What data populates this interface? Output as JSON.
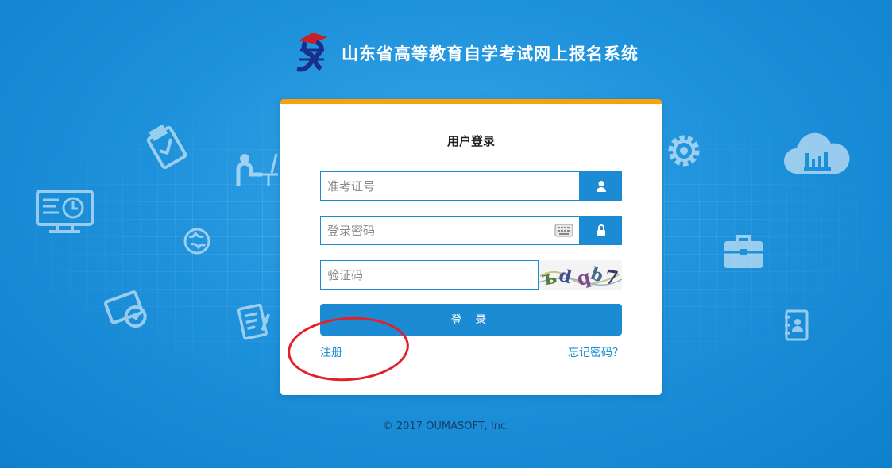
{
  "header": {
    "logo_icon": "exam-logo-icon",
    "title": "山东省高等教育自学考试网上报名系统"
  },
  "login": {
    "title": "用户登录",
    "username_placeholder": "准考证号",
    "username_icon": "user-icon",
    "password_placeholder": "登录密码",
    "password_icon": "lock-icon",
    "keyboard_icon": "keyboard-icon",
    "captcha_placeholder": "验证码",
    "captcha_icon": "captcha-image",
    "submit_label": "登 录",
    "register_link": "注册",
    "forgot_link": "忘记密码？"
  },
  "footer": {
    "copyright": "© 2017 OUMASOFT, Inc."
  },
  "colors": {
    "accent": "#1b8cd4",
    "card_top_border": "#f5a20d",
    "annotation": "#e2202c",
    "background": "#1f92dc"
  },
  "decorative_icons": [
    "clipboard-icon",
    "person-at-desk-icon",
    "monitor-clock-icon",
    "globe-icon",
    "coins-icon",
    "document-edit-icon",
    "gear-icon",
    "cloud-chart-icon",
    "briefcase-icon",
    "contact-book-icon"
  ]
}
